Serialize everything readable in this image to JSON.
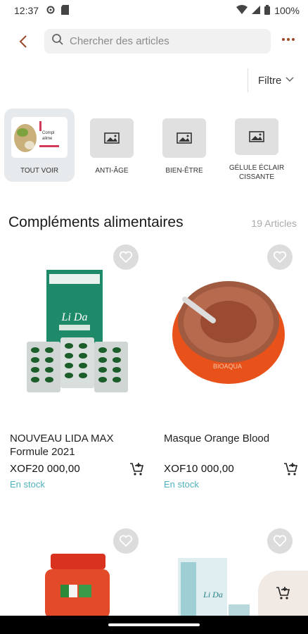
{
  "status": {
    "time": "12:37",
    "battery": "100%",
    "icons": [
      "settings-icon",
      "sd-card-icon",
      "wifi-icon",
      "signal-icon",
      "battery-icon"
    ]
  },
  "search": {
    "placeholder": "Chercher des articles"
  },
  "filter": {
    "label": "Filtre"
  },
  "categories": [
    {
      "label": "TOUT VOIR",
      "active": true
    },
    {
      "label": "ANTI-ÂGE",
      "active": false
    },
    {
      "label": "BIEN-ÊTRE",
      "active": false
    },
    {
      "label": "GÉLULE ÉCLAIR CISSANTE",
      "active": false
    }
  ],
  "category_thumb_text": [
    "Compl",
    "alime"
  ],
  "section": {
    "title": "Compléments alimentaires",
    "count": "19 Articles"
  },
  "products": [
    {
      "name": "NOUVEAU LIDA MAX Formule 2021",
      "price": "XOF20 000,00",
      "stock": "En stock"
    },
    {
      "name": "Masque Orange Blood",
      "price": "XOF10 000,00",
      "stock": "En stock"
    }
  ],
  "colors": {
    "accent": "#9a4a28",
    "stock": "#4fb3bf",
    "search_bg": "#f1f1f1",
    "category_active_bg": "#e6eaed",
    "fab_bg": "#f0e9e4"
  }
}
